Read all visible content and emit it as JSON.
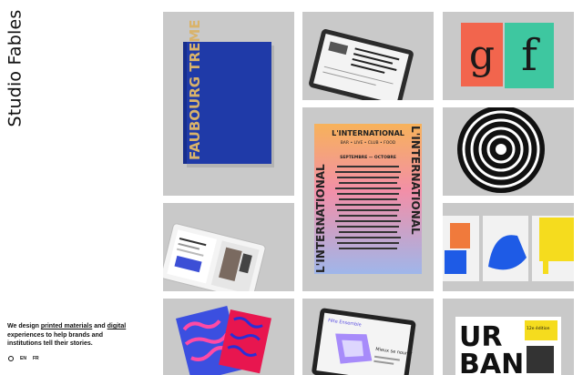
{
  "brand": {
    "name": "Studio Fables"
  },
  "intro": {
    "p1": "We design ",
    "link1": "printed materials",
    "p2": " and ",
    "link2": "digital",
    "p3": " experiences to help brands and institutions tell their stories."
  },
  "languages": [
    {
      "label": "EN"
    },
    {
      "label": "FR"
    }
  ],
  "projects": [
    {
      "name": "Faubourg Treme",
      "cover_text": "FAUBOURG TREME"
    },
    {
      "name": "Tablet website",
      "cover_text": ""
    },
    {
      "name": "Type specimen",
      "cover_text": "gf"
    },
    {
      "name": "L'International",
      "title": "L'INTERNATIONAL",
      "sub": "BAR • LIVE • CLUB • FOOD",
      "months": "SEPTEMBRE — OCTOBRE",
      "vertical": "L'INTERNATIONAL"
    },
    {
      "name": "Rings",
      "cover_text": ""
    },
    {
      "name": "Tablet editorial",
      "cover_text": ""
    },
    {
      "name": "Posters series",
      "cover_text": ""
    },
    {
      "name": "Pink poster",
      "cover_text": ""
    },
    {
      "name": "Tablet app",
      "header": "Fête Ensemble",
      "body": "Mieux se nourrir"
    },
    {
      "name": "Urban",
      "letters": "URBAN",
      "side": "12e édition"
    }
  ],
  "colors": {
    "tile_bg": "#c8c8c8",
    "blue_book": "#1f3aa8",
    "gold": "#d9b36a",
    "poster_orange": "#f07a3c",
    "poster_blue": "#1e5be6",
    "yellow": "#f5dc1e"
  }
}
